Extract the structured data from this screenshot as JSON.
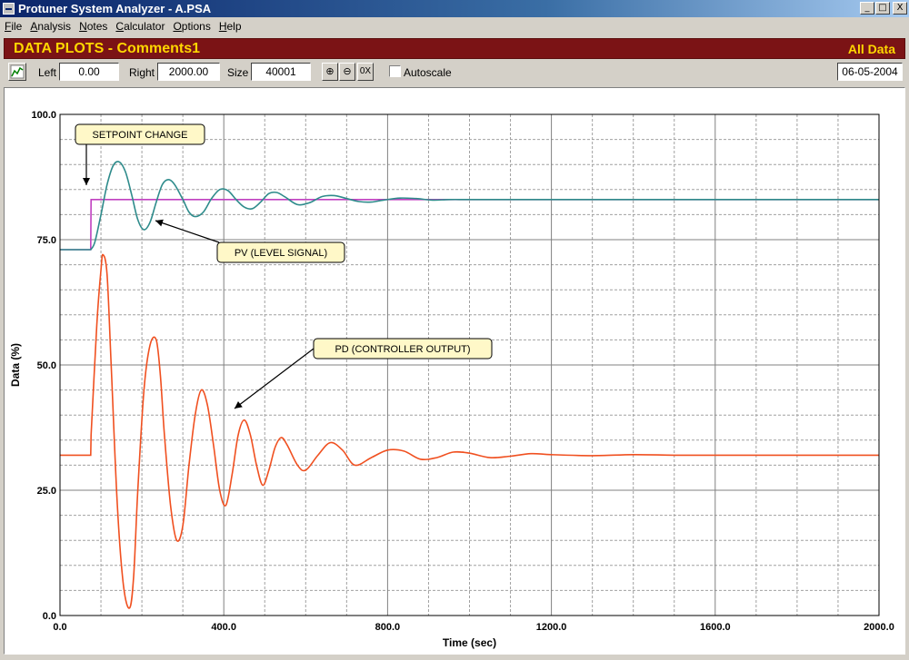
{
  "window": {
    "title": "Protuner System Analyzer - A.PSA",
    "buttons": [
      "_",
      "□",
      "X"
    ]
  },
  "menu": {
    "items": [
      {
        "label": "File",
        "u": "F",
        "rest": "ile"
      },
      {
        "label": "Analysis",
        "u": "A",
        "rest": "nalysis"
      },
      {
        "label": "Notes",
        "u": "N",
        "rest": "otes"
      },
      {
        "label": "Calculator",
        "u": "C",
        "rest": "alculator"
      },
      {
        "label": "Options",
        "u": "O",
        "rest": "ptions"
      },
      {
        "label": "Help",
        "u": "H",
        "rest": "elp"
      }
    ]
  },
  "header": {
    "title": "DATA PLOTS - Comments1",
    "mode": "All Data"
  },
  "toolbar": {
    "left_label": "Left",
    "left_value": "0.00",
    "right_label": "Right",
    "right_value": "2000.00",
    "size_label": "Size",
    "size_value": "40001",
    "zoom_in": "⊕",
    "zoom_out": "⊖",
    "zero_x": "0X",
    "autoscale_label": "Autoscale",
    "autoscale_checked": false,
    "date": "06-05-2004"
  },
  "chart_data": {
    "type": "line",
    "xlabel": "Time (sec)",
    "ylabel": "Data (%)",
    "xlim": [
      0,
      2000
    ],
    "ylim": [
      0,
      100
    ],
    "x_ticks": [
      "0.0",
      "400.0",
      "800.0",
      "1200.0",
      "1600.0",
      "2000.0"
    ],
    "y_ticks": [
      "0.0",
      "25.0",
      "50.0",
      "75.0",
      "100.0"
    ],
    "grid": true,
    "series": [
      {
        "key": "setpoint",
        "color": "#c040c0",
        "x": [
          0,
          75,
          76,
          2000
        ],
        "y": [
          73,
          73,
          83,
          83
        ]
      },
      {
        "key": "pv",
        "color": "#2e8b8b",
        "x": [
          0,
          75,
          85,
          100,
          115,
          130,
          145,
          160,
          175,
          190,
          205,
          220,
          235,
          250,
          265,
          280,
          300,
          315,
          330,
          350,
          370,
          390,
          410,
          430,
          450,
          470,
          490,
          510,
          530,
          550,
          580,
          610,
          640,
          670,
          700,
          730,
          760,
          790,
          830,
          870,
          910,
          950,
          1000,
          1100,
          1200,
          1400,
          1600,
          2000
        ],
        "y": [
          73,
          73,
          74.5,
          80,
          86,
          89.8,
          90.5,
          88.5,
          84,
          79,
          77,
          78.5,
          82.5,
          86,
          87,
          86,
          83,
          80.5,
          79.6,
          80.5,
          83.2,
          85,
          84.8,
          83,
          81.5,
          81.2,
          82.5,
          84.2,
          84.4,
          83.5,
          82,
          82.4,
          83.6,
          83.8,
          83.2,
          82.6,
          82.5,
          82.9,
          83.3,
          83.2,
          82.9,
          83,
          83,
          83,
          83,
          83,
          83,
          83
        ]
      },
      {
        "key": "pd",
        "color": "#f05020",
        "x": [
          0,
          75,
          76,
          90,
          100,
          105,
          115,
          125,
          140,
          155,
          170,
          180,
          190,
          205,
          220,
          235,
          245,
          255,
          270,
          285,
          300,
          315,
          330,
          345,
          360,
          375,
          390,
          405,
          420,
          435,
          450,
          465,
          480,
          495,
          510,
          525,
          540,
          555,
          580,
          600,
          630,
          660,
          690,
          720,
          760,
          800,
          840,
          880,
          920,
          960,
          1000,
          1050,
          1100,
          1150,
          1200,
          1300,
          1400,
          1500,
          1600,
          1800,
          2000
        ],
        "y": [
          32,
          32,
          36,
          58,
          69,
          72,
          68,
          50,
          22,
          6,
          1.5,
          8,
          25,
          45,
          54,
          55,
          48,
          36,
          22,
          15,
          18,
          30,
          40,
          45,
          42,
          34,
          25,
          22,
          28,
          36,
          39,
          36,
          30,
          26,
          29,
          33.5,
          35.5,
          34,
          30,
          29,
          32,
          34.5,
          33,
          30,
          31.5,
          33,
          32.8,
          31.2,
          31.5,
          32.6,
          32.4,
          31.5,
          31.8,
          32.3,
          32.1,
          31.9,
          32.1,
          32,
          32,
          32,
          32
        ]
      }
    ],
    "annotations": [
      {
        "key": "setpoint_change",
        "text": "SETPOINT CHANGE"
      },
      {
        "key": "pv_label",
        "text": "PV (LEVEL SIGNAL)"
      },
      {
        "key": "pd_label",
        "text": "PD (CONTROLLER OUTPUT)"
      }
    ]
  }
}
